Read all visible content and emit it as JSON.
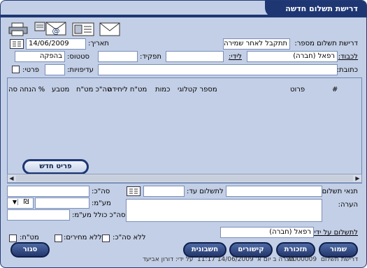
{
  "window": {
    "title": "דרישת תשלום חדשה"
  },
  "toolbar": {
    "icons": [
      "envelope-icon",
      "fax-icon",
      "email-icon",
      "printer-icon"
    ]
  },
  "header": {
    "request_number_label": "דרישת תשלום מספר:",
    "request_number_value": "תתקבל לאחר שמירה",
    "date_label": "תאריך:",
    "date_value": "14/06/2009",
    "to_label": "לכבוד:",
    "to_value": "רפאל (חברה)",
    "attention_label": "לידי:",
    "attention_value": "",
    "role_label": "תפקיד:",
    "role_value": "",
    "status_label": "סטטוס:",
    "status_value": "בהפקה",
    "address_label": "כתובת:",
    "address_value": "",
    "priorities_label": "עדיפויות:",
    "priorities_value": "",
    "private_label": "פרטי:"
  },
  "grid": {
    "columns": [
      "#",
      "פרוט",
      "מספר קטלוגי",
      "כמות",
      "מט\"ח ליחידה",
      "סה\"כ מט\"ח",
      "מטבע",
      "% הנחה",
      "סה"
    ],
    "rows": []
  },
  "new_item_button": "פריט חדש",
  "footer": {
    "payment_terms_label": "תנאי תשלום:",
    "payment_terms_value": "",
    "pay_until_label": "לתשלום עד:",
    "pay_until_value": "",
    "total_label": "סה\"כ:",
    "total_value": "",
    "vat_label": "מע\"מ:",
    "vat_value": "",
    "vat_currency": "₪",
    "total_incl_vat_label": "סה\"כ כולל מע\"מ:",
    "total_incl_vat_value": "",
    "note_label": "הערה:",
    "note_value": "",
    "paid_by_label": "לתשלום על ידי:",
    "paid_by_value": "רפאל (חברה)",
    "no_total_label": "ללא סה\"כ:",
    "no_prices_label": "ללא מחירים:",
    "fx_label": "מט\"ח:"
  },
  "buttons": {
    "save": "שמור",
    "reminders": "תזכורת",
    "links": "קישורים",
    "invoice": "חשבונית",
    "close": "סגור"
  },
  "statusbar": {
    "doc_type": "דרישת תשלום",
    "doc_number": "0000009",
    "created_text": "נוצרה ב יום א' 14/06/2009 11:17",
    "by_text": "על ידי: דורון אביעד"
  }
}
